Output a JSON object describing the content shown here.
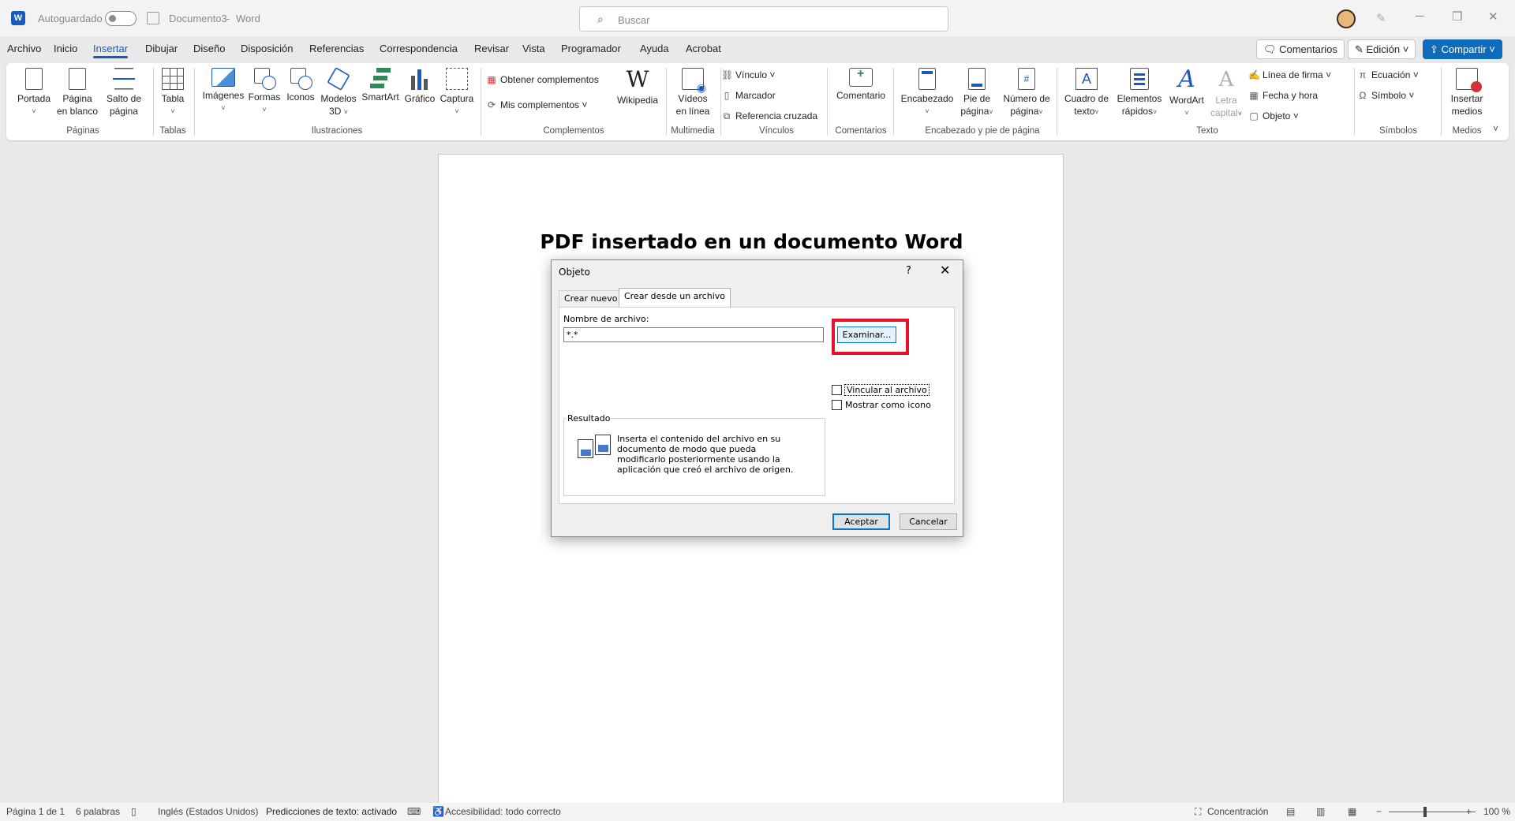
{
  "titlebar": {
    "autosave_label": "Autoguardado",
    "doc_name": "Documento3",
    "separator": "-",
    "app_name": "Word",
    "search_placeholder": "Buscar"
  },
  "menu": {
    "tabs": [
      "Archivo",
      "Inicio",
      "Insertar",
      "Dibujar",
      "Diseño",
      "Disposición",
      "Referencias",
      "Correspondencia",
      "Revisar",
      "Vista",
      "Programador",
      "Ayuda",
      "Acrobat"
    ],
    "active": "Insertar",
    "comments_btn": "Comentarios",
    "editing_btn": "Edición",
    "share_btn": "Compartir"
  },
  "ribbon": {
    "pages": {
      "portada": "Portada",
      "blank1": "Página",
      "blank2": "en blanco",
      "break1": "Salto de",
      "break2": "página",
      "label": "Páginas"
    },
    "tables": {
      "table": "Tabla",
      "label": "Tablas"
    },
    "illustrations": {
      "images": "Imágenes",
      "shapes": "Formas",
      "icons": "Iconos",
      "models1": "Modelos",
      "models2": "3D",
      "smartart": "SmartArt",
      "chart": "Gráfico",
      "capture": "Captura",
      "label": "Ilustraciones"
    },
    "addins": {
      "get": "Obtener complementos",
      "mine": "Mis complementos",
      "wiki": "Wikipedia",
      "label": "Complementos"
    },
    "media": {
      "video1": "Vídeos",
      "video2": "en línea",
      "label": "Multimedia"
    },
    "links": {
      "link": "Vínculo",
      "bookmark": "Marcador",
      "xref": "Referencia cruzada",
      "label": "Vínculos"
    },
    "comments": {
      "comment": "Comentario",
      "label": "Comentarios"
    },
    "headerfooter": {
      "header": "Encabezado",
      "footer1": "Pie de",
      "footer2": "página",
      "pagenum1": "Número de",
      "pagenum2": "página",
      "label": "Encabezado y pie de página"
    },
    "text": {
      "textbox1": "Cuadro de",
      "textbox2": "texto",
      "quick1": "Elementos",
      "quick2": "rápidos",
      "wordart": "WordArt",
      "dropcap1": "Letra",
      "dropcap2": "capital",
      "signature": "Línea de firma",
      "datetime": "Fecha y hora",
      "object": "Objeto",
      "label": "Texto"
    },
    "symbols": {
      "equation": "Ecuación",
      "symbol": "Símbolo",
      "label": "Símbolos"
    },
    "medios": {
      "insert1": "Insertar",
      "insert2": "medios",
      "label": "Medios"
    }
  },
  "document": {
    "title": "PDF insertado en un documento Word"
  },
  "dialog": {
    "title": "Objeto",
    "help": "?",
    "tabs": [
      "Crear nuevo",
      "Crear desde un archivo"
    ],
    "active_tab": "Crear desde un archivo",
    "filename_label": "Nombre de archivo:",
    "filename_value": "*.*",
    "browse": "Examinar...",
    "link_to_file": "Vincular al archivo",
    "show_as_icon": "Mostrar como icono",
    "result_label": "Resultado",
    "result_text": "Inserta el contenido del archivo en su documento de modo que pueda modificarlo posteriormente usando la aplicación que creó el archivo de origen.",
    "ok": "Aceptar",
    "cancel": "Cancelar"
  },
  "statusbar": {
    "page": "Página 1 de 1",
    "words": "6 palabras",
    "language": "Inglés (Estados Unidos)",
    "predictions": "Predicciones de texto: activado",
    "accessibility": "Accesibilidad: todo correcto",
    "focus": "Concentración",
    "zoom": "100 %"
  },
  "colors": {
    "accent": "#185abd",
    "share": "#0f6cbd",
    "highlight": "#e8102a"
  }
}
